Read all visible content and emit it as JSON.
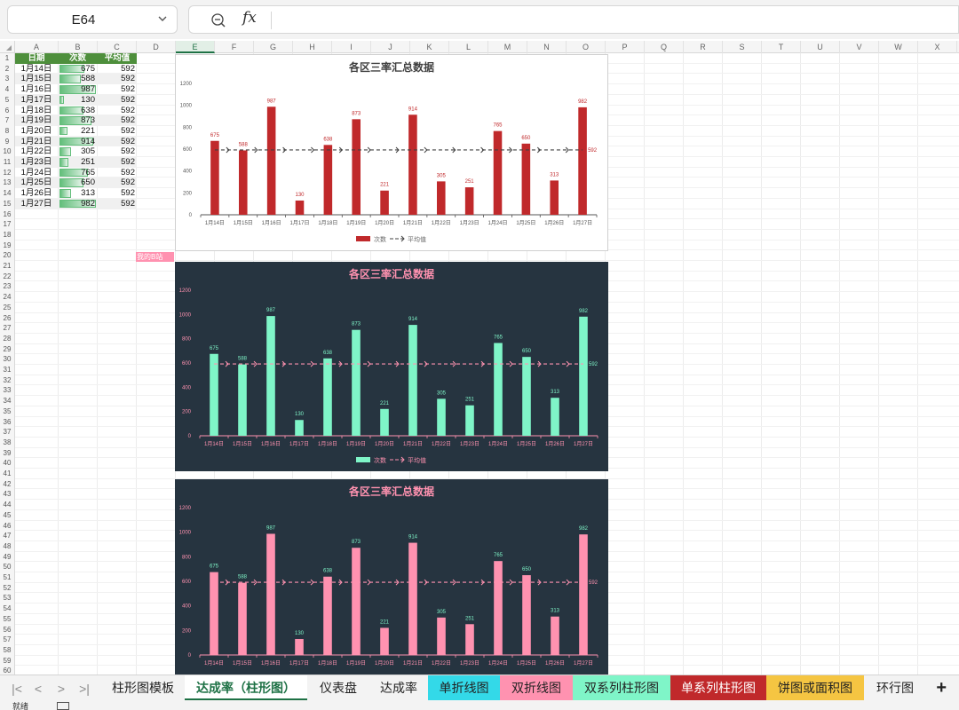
{
  "name_box": "E64",
  "formula_icon": "fx",
  "columns": [
    "A",
    "B",
    "C",
    "D",
    "E",
    "F",
    "G",
    "H",
    "I",
    "J",
    "K",
    "L",
    "M",
    "N",
    "O",
    "P",
    "Q",
    "R",
    "S",
    "T",
    "U",
    "V",
    "W",
    "X"
  ],
  "selected_column": "E",
  "rows": [
    "1",
    "2",
    "3",
    "4",
    "5",
    "6",
    "7",
    "8",
    "9",
    "10",
    "11",
    "12",
    "13",
    "14",
    "15",
    "16",
    "17",
    "18",
    "19",
    "20",
    "21",
    "22",
    "23",
    "24",
    "25",
    "26",
    "27",
    "28",
    "29",
    "30",
    "31",
    "32",
    "33",
    "34",
    "35",
    "36",
    "37",
    "38",
    "39",
    "40",
    "41",
    "42",
    "43",
    "44",
    "45",
    "46",
    "47",
    "48",
    "49",
    "50",
    "51",
    "52",
    "53",
    "54",
    "55",
    "56",
    "57",
    "58",
    "59",
    "60"
  ],
  "table": {
    "headers": [
      "日期",
      "次数",
      "平均值"
    ],
    "rows": [
      {
        "date": "1月14日",
        "count": 675,
        "avg": 592
      },
      {
        "date": "1月15日",
        "count": 588,
        "avg": 592
      },
      {
        "date": "1月16日",
        "count": 987,
        "avg": 592
      },
      {
        "date": "1月17日",
        "count": 130,
        "avg": 592
      },
      {
        "date": "1月18日",
        "count": 638,
        "avg": 592
      },
      {
        "date": "1月19日",
        "count": 873,
        "avg": 592
      },
      {
        "date": "1月20日",
        "count": 221,
        "avg": 592
      },
      {
        "date": "1月21日",
        "count": 914,
        "avg": 592
      },
      {
        "date": "1月22日",
        "count": 305,
        "avg": 592
      },
      {
        "date": "1月23日",
        "count": 251,
        "avg": 592
      },
      {
        "date": "1月24日",
        "count": 765,
        "avg": 592
      },
      {
        "date": "1月25日",
        "count": 650,
        "avg": 592
      },
      {
        "date": "1月26日",
        "count": 313,
        "avg": 592
      },
      {
        "date": "1月27日",
        "count": 982,
        "avg": 592
      }
    ]
  },
  "pink_tag": "我的B站",
  "chart_data": [
    {
      "type": "bar",
      "title": "各区三率汇总数据",
      "categories": [
        "1月14日",
        "1月15日",
        "1月16日",
        "1月17日",
        "1月18日",
        "1月19日",
        "1月20日",
        "1月21日",
        "1月22日",
        "1月23日",
        "1月24日",
        "1月25日",
        "1月26日",
        "1月27日"
      ],
      "series": [
        {
          "name": "次数",
          "type": "bar",
          "values": [
            675,
            588,
            987,
            130,
            638,
            873,
            221,
            914,
            305,
            251,
            765,
            650,
            313,
            982
          ]
        },
        {
          "name": "平均值",
          "type": "line",
          "values": [
            592,
            592,
            592,
            592,
            592,
            592,
            592,
            592,
            592,
            592,
            592,
            592,
            592,
            592
          ]
        }
      ],
      "ylim": [
        0,
        1200
      ],
      "yticks": [
        0,
        200,
        400,
        600,
        800,
        1000,
        1200
      ],
      "avg_label": "592",
      "legend": "bottom",
      "theme": {
        "bg": "#ffffff",
        "title": "#404040",
        "bar": "#c0292b",
        "label": "#c0292b",
        "line": "#404040",
        "axis": "#555555",
        "legend_text": "#666666"
      }
    },
    {
      "type": "bar",
      "title": "各区三率汇总数据",
      "categories": [
        "1月14日",
        "1月15日",
        "1月16日",
        "1月17日",
        "1月18日",
        "1月19日",
        "1月20日",
        "1月21日",
        "1月22日",
        "1月23日",
        "1月24日",
        "1月25日",
        "1月26日",
        "1月27日"
      ],
      "series": [
        {
          "name": "次数",
          "type": "bar",
          "values": [
            675,
            588,
            987,
            130,
            638,
            873,
            221,
            914,
            305,
            251,
            765,
            650,
            313,
            982
          ]
        },
        {
          "name": "平均值",
          "type": "line",
          "values": [
            592,
            592,
            592,
            592,
            592,
            592,
            592,
            592,
            592,
            592,
            592,
            592,
            592,
            592
          ]
        }
      ],
      "ylim": [
        0,
        1200
      ],
      "yticks": [
        0,
        200,
        400,
        600,
        800,
        1000,
        1200
      ],
      "avg_label": "592",
      "legend": "bottom",
      "theme": {
        "bg": "#263440",
        "title": "#ff92b0",
        "bar": "#7ff5c8",
        "label": "#7ff5c8",
        "line": "#ff92b0",
        "axis": "#ff92b0",
        "legend_text": "#ff92b0"
      }
    },
    {
      "type": "bar",
      "title": "各区三率汇总数据",
      "categories": [
        "1月14日",
        "1月15日",
        "1月16日",
        "1月17日",
        "1月18日",
        "1月19日",
        "1月20日",
        "1月21日",
        "1月22日",
        "1月23日",
        "1月24日",
        "1月25日",
        "1月26日",
        "1月27日"
      ],
      "series": [
        {
          "name": "次数",
          "type": "bar",
          "values": [
            675,
            588,
            987,
            130,
            638,
            873,
            221,
            914,
            305,
            251,
            765,
            650,
            313,
            982
          ]
        },
        {
          "name": "平均值",
          "type": "line",
          "values": [
            592,
            592,
            592,
            592,
            592,
            592,
            592,
            592,
            592,
            592,
            592,
            592,
            592,
            592
          ]
        }
      ],
      "ylim": [
        0,
        1200
      ],
      "yticks": [
        0,
        200,
        400,
        600,
        800,
        1000,
        1200
      ],
      "avg_label": "592",
      "legend": "none",
      "theme": {
        "bg": "#263440",
        "title": "#ff92b0",
        "bar": "#ff92b0",
        "label": "#7ff5c8",
        "line": "#ff92b0",
        "axis": "#ff92b0",
        "legend_text": "#ff92b0"
      }
    }
  ],
  "sheet_tabs": [
    {
      "label": "柱形图模板",
      "color": "#f3f3f3",
      "text": "#222222",
      "active": false
    },
    {
      "label": "达成率（柱形图）",
      "color": "#ffffff",
      "text": "#1e7145",
      "active": true
    },
    {
      "label": "仪表盘",
      "color": "#f3f3f3",
      "text": "#222222",
      "active": false
    },
    {
      "label": "达成率",
      "color": "#f3f3f3",
      "text": "#222222",
      "active": false
    },
    {
      "label": "单折线图",
      "color": "#33d9e8",
      "text": "#222222",
      "active": false
    },
    {
      "label": "双折线图",
      "color": "#ff92b0",
      "text": "#222222",
      "active": false
    },
    {
      "label": "双系列柱形图",
      "color": "#7ff5c8",
      "text": "#222222",
      "active": false
    },
    {
      "label": "单系列柱形图",
      "color": "#c0292b",
      "text": "#ffffff",
      "active": false
    },
    {
      "label": "饼图或面积图",
      "color": "#f5c542",
      "text": "#222222",
      "active": false
    },
    {
      "label": "环行图",
      "color": "#f3f3f3",
      "text": "#222222",
      "active": false
    }
  ],
  "nav_buttons": [
    "|<",
    "<",
    ">",
    ">|"
  ],
  "add_sheet": "+",
  "status_text": "就绪"
}
